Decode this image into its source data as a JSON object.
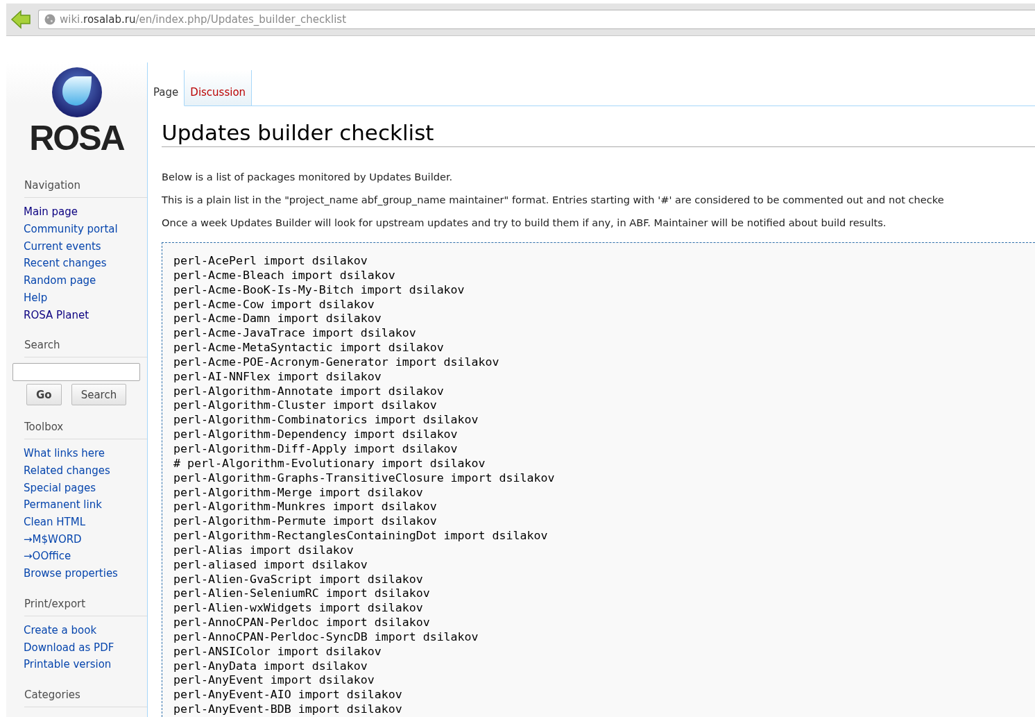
{
  "browser": {
    "url_host_prefix": "wiki.",
    "url_host": "rosalab.ru",
    "url_path": "/en/index.php/Updates_builder_checklist"
  },
  "logo": {
    "text": "ROSA"
  },
  "tabs": [
    {
      "label": "Page",
      "selected": true
    },
    {
      "label": "Discussion",
      "selected": false
    }
  ],
  "sidebar": {
    "sections": [
      {
        "title": "Navigation",
        "links": [
          {
            "label": "Main page",
            "visited": true
          },
          {
            "label": "Community portal",
            "visited": false
          },
          {
            "label": "Current events",
            "visited": false
          },
          {
            "label": "Recent changes",
            "visited": false
          },
          {
            "label": "Random page",
            "visited": false
          },
          {
            "label": "Help",
            "visited": false
          },
          {
            "label": "ROSA Planet",
            "visited": true
          }
        ]
      },
      {
        "title": "Search",
        "kind": "search",
        "buttons": [
          "Go",
          "Search"
        ]
      },
      {
        "title": "Toolbox",
        "links": [
          {
            "label": "What links here",
            "visited": false
          },
          {
            "label": "Related changes",
            "visited": false
          },
          {
            "label": "Special pages",
            "visited": false
          },
          {
            "label": "Permanent link",
            "visited": false
          },
          {
            "label": "Clean HTML",
            "visited": false
          },
          {
            "label": "→M$WORD",
            "visited": false
          },
          {
            "label": "→OOffice",
            "visited": false
          },
          {
            "label": "Browse properties",
            "visited": false
          }
        ]
      },
      {
        "title": "Print/export",
        "links": [
          {
            "label": "Create a book",
            "visited": false
          },
          {
            "label": "Download as PDF",
            "visited": false
          },
          {
            "label": "Printable version",
            "visited": false
          }
        ]
      },
      {
        "title": "Categories"
      }
    ]
  },
  "article": {
    "title": "Updates builder checklist",
    "paragraphs": [
      "Below is a list of packages monitored by Updates Builder.",
      "This is a plain list in the \"project_name abf_group_name maintainer\" format. Entries starting with '#' are considered to be commented out and not checke",
      "Once a week Updates Builder will look for upstream updates and try to build them if any, in ABF. Maintainer will be notified about build results."
    ],
    "code_lines": [
      "perl-AcePerl import dsilakov",
      "perl-Acme-Bleach import dsilakov",
      "perl-Acme-BooK-Is-My-Bitch import dsilakov",
      "perl-Acme-Cow import dsilakov",
      "perl-Acme-Damn import dsilakov",
      "perl-Acme-JavaTrace import dsilakov",
      "perl-Acme-MetaSyntactic import dsilakov",
      "perl-Acme-POE-Acronym-Generator import dsilakov",
      "perl-AI-NNFlex import dsilakov",
      "perl-Algorithm-Annotate import dsilakov",
      "perl-Algorithm-Cluster import dsilakov",
      "perl-Algorithm-Combinatorics import dsilakov",
      "perl-Algorithm-Dependency import dsilakov",
      "perl-Algorithm-Diff-Apply import dsilakov",
      "# perl-Algorithm-Evolutionary import dsilakov",
      "perl-Algorithm-Graphs-TransitiveClosure import dsilakov",
      "perl-Algorithm-Merge import dsilakov",
      "perl-Algorithm-Munkres import dsilakov",
      "perl-Algorithm-Permute import dsilakov",
      "perl-Algorithm-RectanglesContainingDot import dsilakov",
      "perl-Alias import dsilakov",
      "perl-aliased import dsilakov",
      "perl-Alien-GvaScript import dsilakov",
      "perl-Alien-SeleniumRC import dsilakov",
      "perl-Alien-wxWidgets import dsilakov",
      "perl-AnnoCPAN-Perldoc import dsilakov",
      "perl-AnnoCPAN-Perldoc-SyncDB import dsilakov",
      "perl-ANSIColor import dsilakov",
      "perl-AnyData import dsilakov",
      "perl-AnyEvent import dsilakov",
      "perl-AnyEvent-AIO import dsilakov",
      "perl-AnyEvent-BDB import dsilakov"
    ]
  }
}
